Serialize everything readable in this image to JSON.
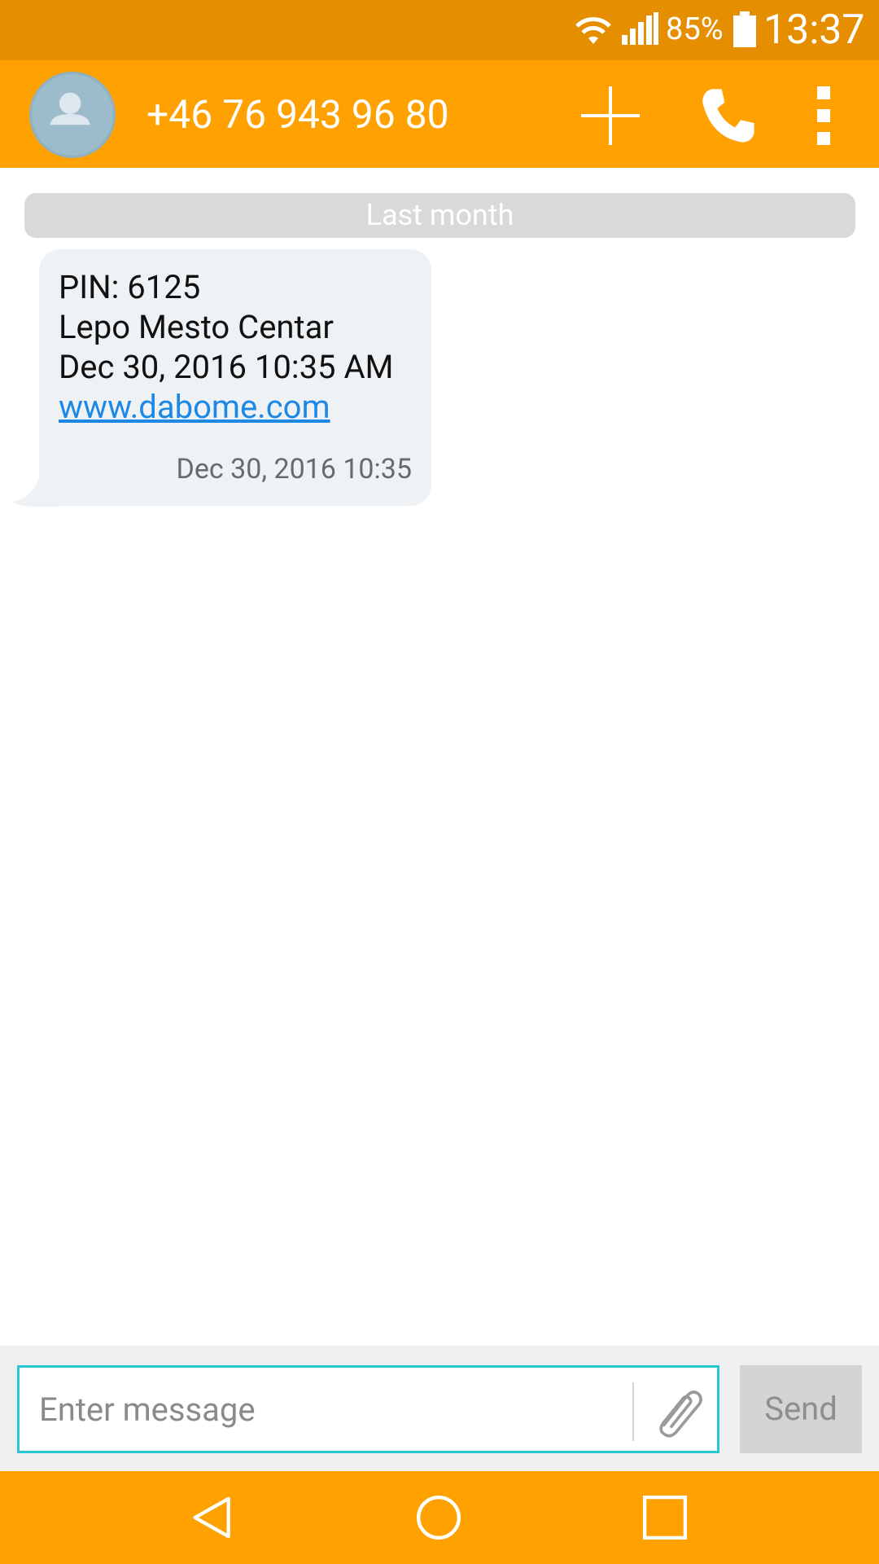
{
  "status_bar": {
    "battery_percent": "85%",
    "time": "13:37",
    "icons": [
      "wifi-icon",
      "signal-icon",
      "battery-icon"
    ]
  },
  "app_bar": {
    "contact_number": "+46 76 943 96 80",
    "icons": [
      "avatar-placeholder-icon",
      "plus-icon",
      "phone-icon",
      "more-vert-icon"
    ]
  },
  "conversation": {
    "date_separator": "Last month",
    "messages": [
      {
        "lines": [
          "PIN: 6125",
          "Lepo Mesto Centar",
          "Dec 30, 2016 10:35 AM"
        ],
        "link": "www.dabome.com",
        "timestamp": "Dec 30, 2016 10:35"
      }
    ]
  },
  "compose": {
    "placeholder": "Enter message",
    "send_label": "Send",
    "attach_icon": "paperclip-icon"
  },
  "nav_bar": {
    "icons": [
      "back-icon",
      "home-icon",
      "recents-icon"
    ]
  },
  "colors": {
    "status_bar": "#e58e00",
    "app_bar": "#ffa100",
    "bubble": "#eff2f5",
    "link": "#1e88e5",
    "compose_border": "#28c8d2"
  }
}
